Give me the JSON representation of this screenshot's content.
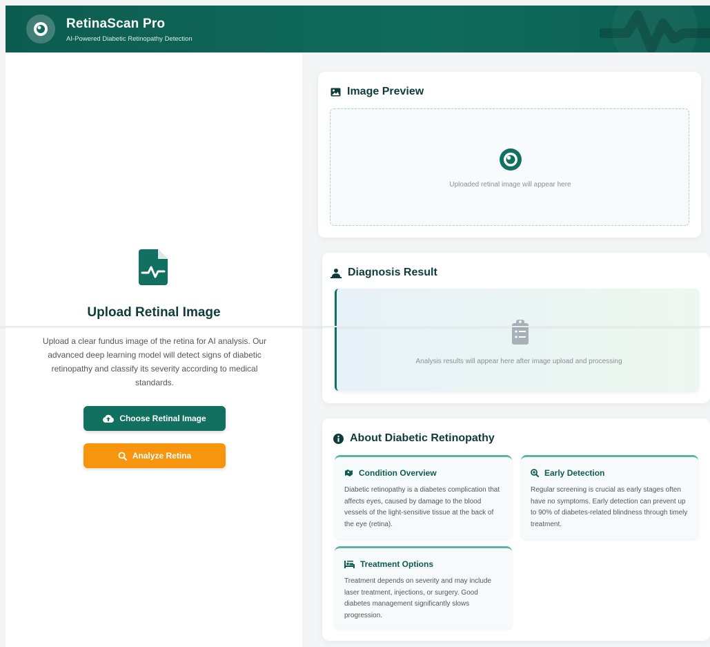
{
  "header": {
    "title": "RetinaScan Pro",
    "subtitle": "AI-Powered Diabetic Retinopathy Detection"
  },
  "upload": {
    "title": "Upload Retinal Image",
    "description": "Upload a clear fundus image of the retina for AI analysis. Our advanced deep learning model will detect signs of diabetic retinopathy and classify its severity according to medical standards.",
    "choose_label": "Choose Retinal Image",
    "analyze_label": "Analyze Retina"
  },
  "preview": {
    "title": "Image Preview",
    "placeholder": "Uploaded retinal image will appear here"
  },
  "diagnosis": {
    "title": "Diagnosis Result",
    "placeholder": "Analysis results will appear here after image upload and processing"
  },
  "about": {
    "title": "About Diabetic Retinopathy",
    "items": [
      {
        "title": "Condition Overview",
        "text": "Diabetic retinopathy is a diabetes complication that affects eyes, caused by damage to the blood vessels of the light-sensitive tissue at the back of the eye (retina)."
      },
      {
        "title": "Early Detection",
        "text": "Regular screening is crucial as early stages often have no symptoms. Early detection can prevent up to 90% of diabetes-related blindness through timely treatment."
      },
      {
        "title": "Treatment Options",
        "text": "Treatment depends on severity and may include laser treatment, injections, or surgery. Good diabetes management significantly slows progression."
      }
    ]
  },
  "colors": {
    "primary": "#11705f",
    "accent": "#f7950e",
    "header": "#0d5c50"
  }
}
